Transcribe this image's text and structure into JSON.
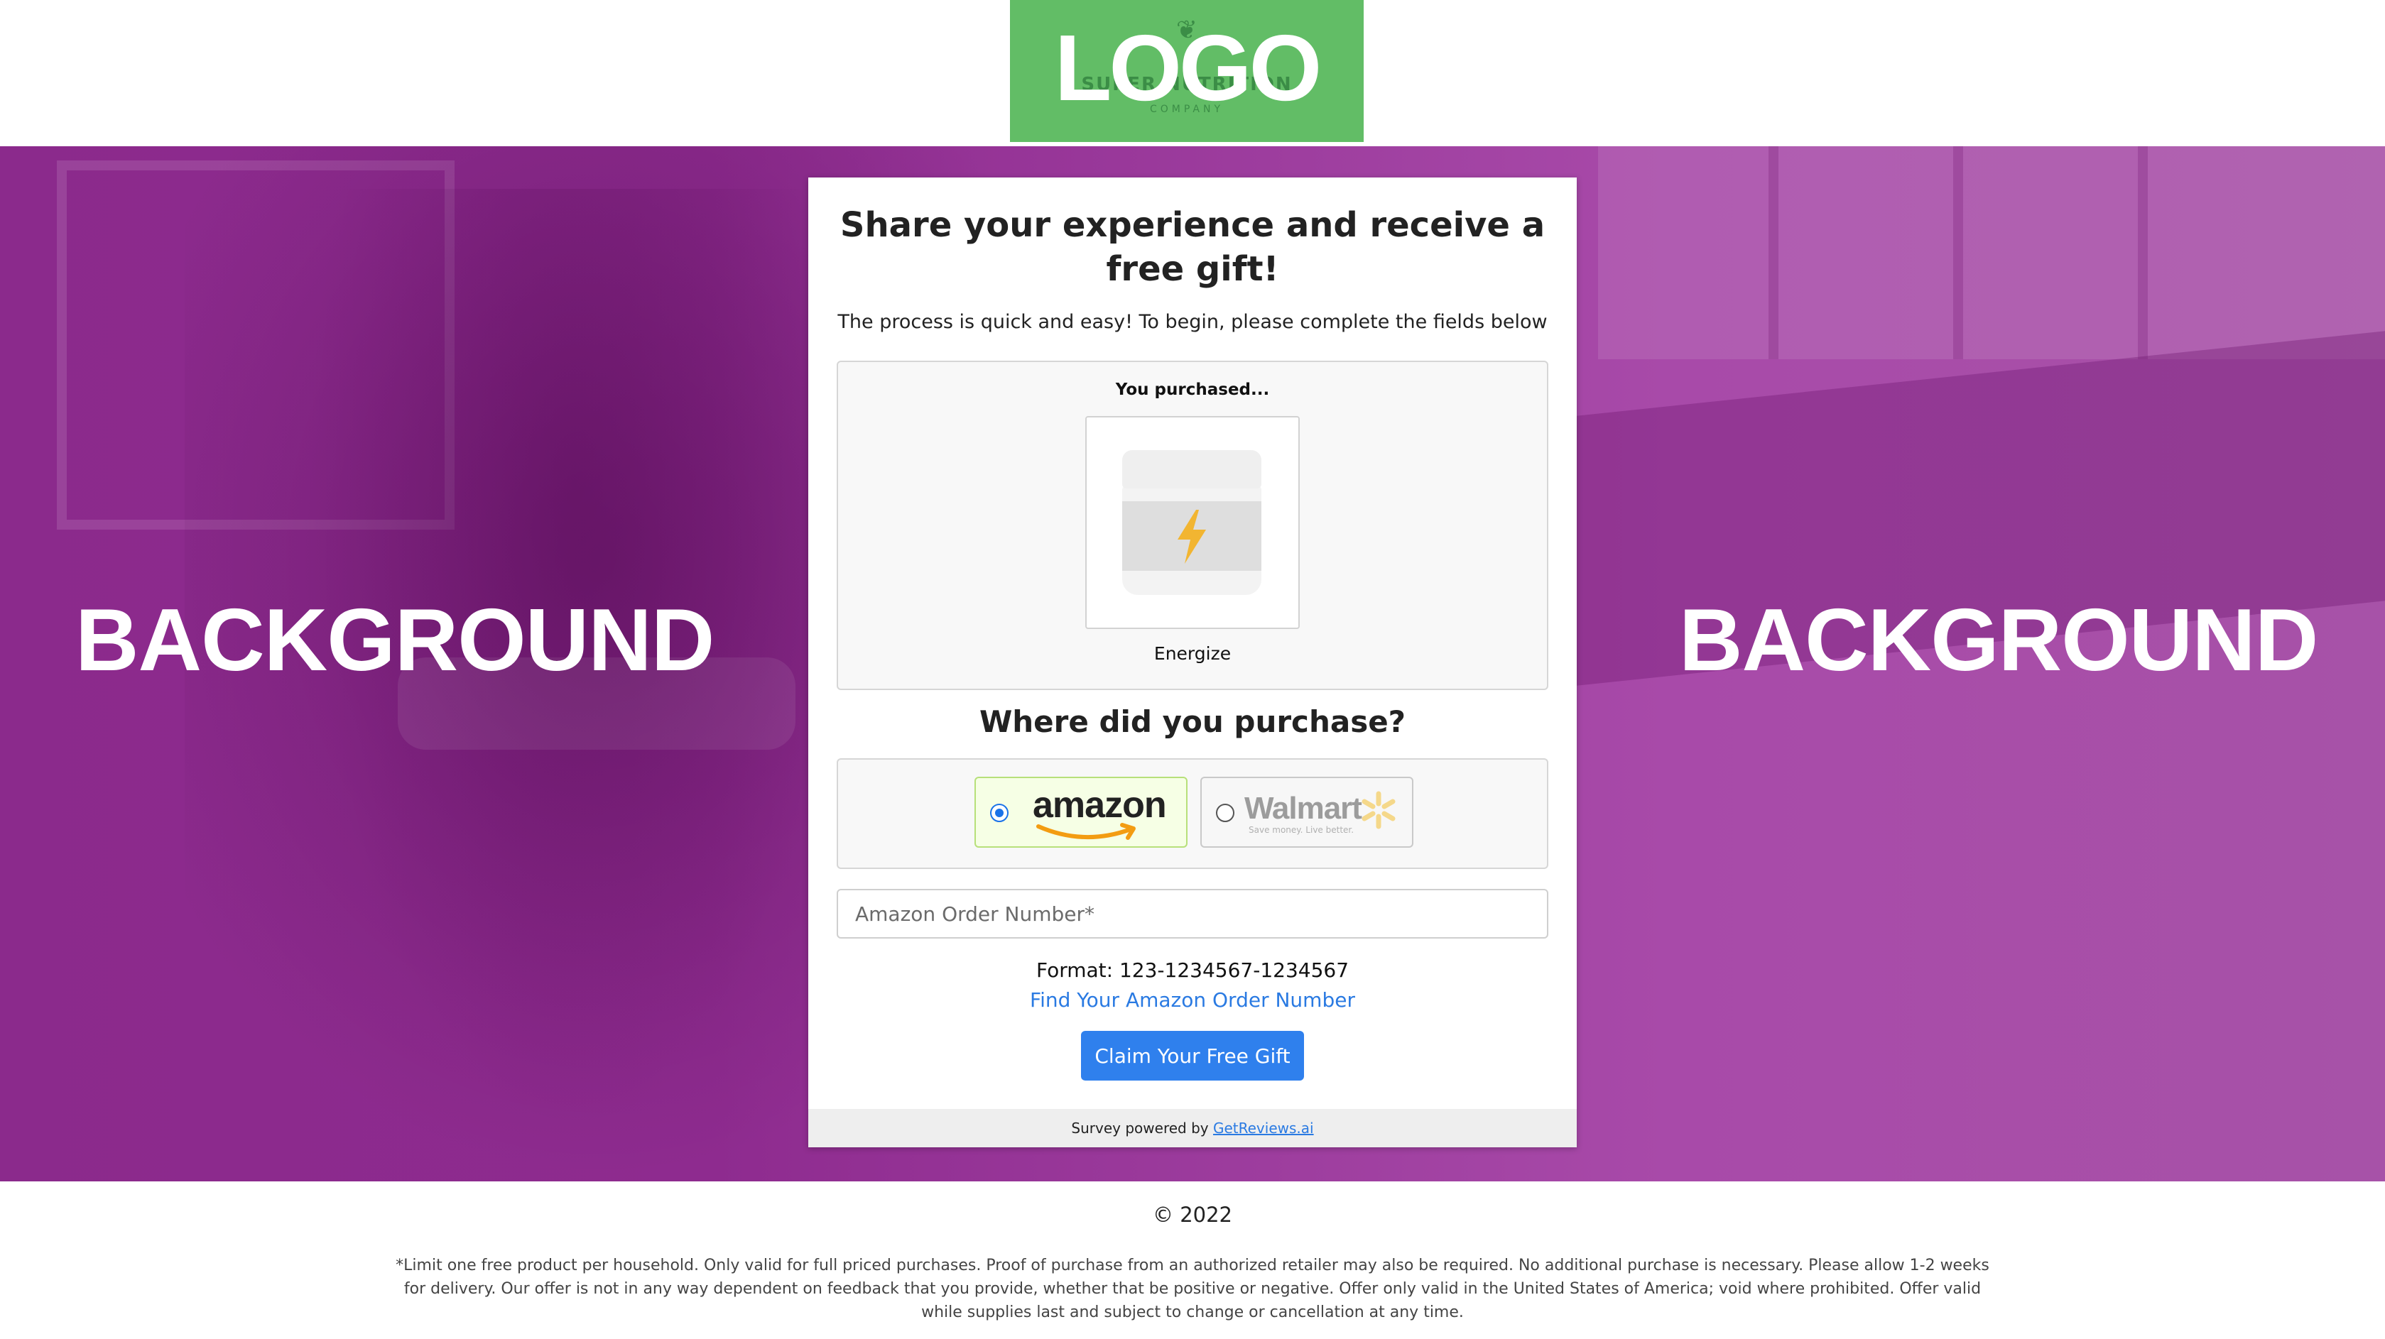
{
  "header": {
    "logo_text": "LOGO",
    "logo_underlay_text": "SUPER NUTRITION",
    "logo_underlay_sub": "COMPANY",
    "logo_color": "#62bd66"
  },
  "hero": {
    "left_label": "BACKGROUND",
    "right_label": "BACKGROUND",
    "overlay_color": "#8e2b8f"
  },
  "card": {
    "title": "Share your experience and receive a free gift!",
    "subtitle": "The process is quick and easy! To begin, please complete the fields below",
    "product": {
      "heading": "You purchased...",
      "name": "Energize",
      "icon": "lightning-bolt-icon"
    },
    "where": {
      "heading": "Where did you purchase?",
      "options": [
        {
          "label": "amazon",
          "selected": true
        },
        {
          "label": "Walmart",
          "tagline": "Save money. Live better.",
          "selected": false
        }
      ]
    },
    "order_input": {
      "placeholder": "Amazon Order Number*",
      "value": ""
    },
    "format_text": "Format: 123-1234567-1234567",
    "find_link": "Find Your Amazon Order Number",
    "submit_label": "Claim Your Free Gift",
    "footer": {
      "prefix": "Survey powered by",
      "brand": "GetReviews.ai"
    },
    "accent_color": "#2f80ed"
  },
  "footer": {
    "copyright": "© 2022",
    "disclaimer": "*Limit one free product per household. Only valid for full priced purchases. Proof of purchase from an authorized retailer may also be required. No additional purchase is necessary. Please allow 1-2 weeks for delivery. Our offer is not in any way dependent on feedback that you provide, whether that be positive or negative. Offer only valid in the United States of America; void where prohibited. Offer valid while supplies last and subject to change or cancellation at any time."
  }
}
